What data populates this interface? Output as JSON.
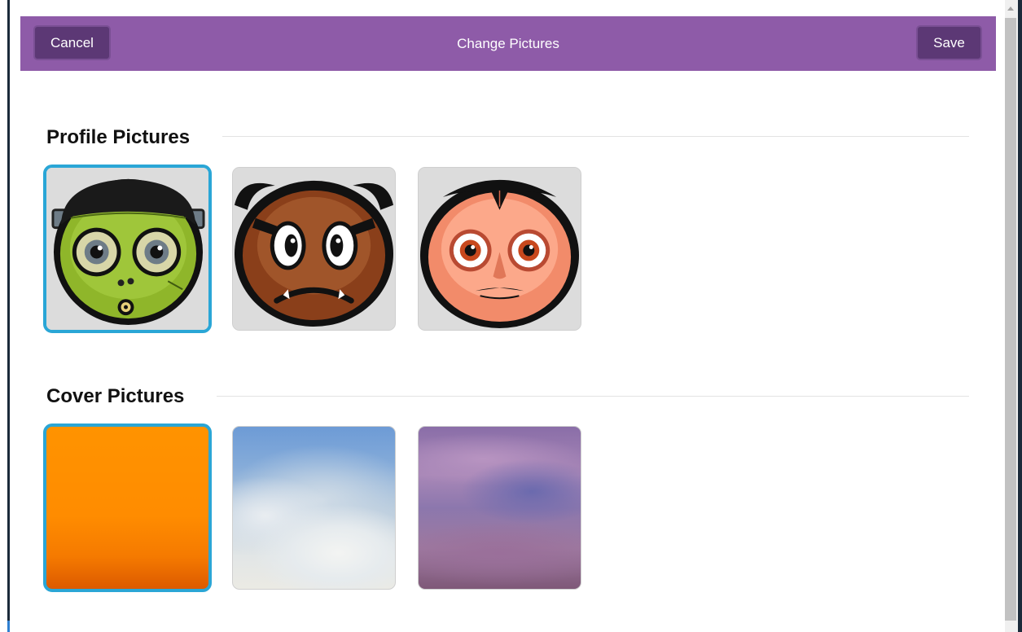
{
  "header": {
    "title": "Change Pictures",
    "cancel_label": "Cancel",
    "save_label": "Save",
    "background_color": "#8e5ba8",
    "button_color": "#5c3875"
  },
  "profile_section": {
    "title": "Profile Pictures",
    "items": [
      {
        "name": "frankenstein-avatar",
        "selected": true
      },
      {
        "name": "goomba-avatar",
        "selected": false
      },
      {
        "name": "dracula-avatar",
        "selected": false
      }
    ]
  },
  "cover_section": {
    "title": "Cover Pictures",
    "items": [
      {
        "name": "orange-cover",
        "selected": true
      },
      {
        "name": "sky-clouds-cover",
        "selected": false
      },
      {
        "name": "purple-clouds-cover",
        "selected": false
      }
    ]
  },
  "selection_color": "#2aa6d6"
}
